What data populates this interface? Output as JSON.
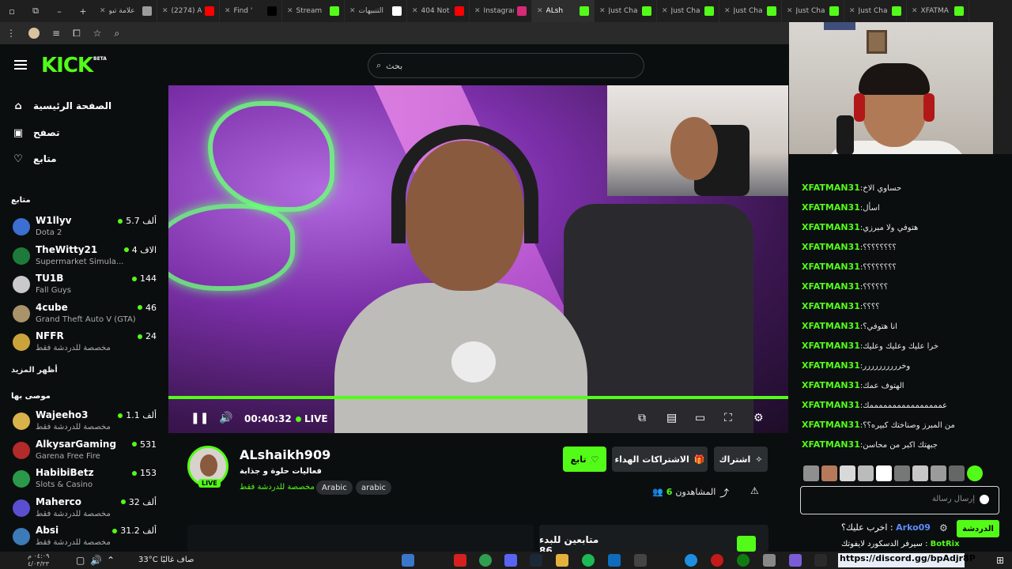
{
  "browser": {
    "tabs": [
      {
        "label": "علامة تبو",
        "color": "#9c9c9c"
      },
      {
        "label": "(2274) A",
        "color": "#ff0000"
      },
      {
        "label": "Find '",
        "color": "#000000"
      },
      {
        "label": "Stream",
        "color": "#53fc18"
      },
      {
        "label": "التنبيهات",
        "color": "#ffffff"
      },
      {
        "label": "404 Not",
        "color": "#ff0000"
      },
      {
        "label": "Instagran",
        "color": "#d62976"
      },
      {
        "label": "ALsh",
        "color": "#53fc18",
        "active": true
      },
      {
        "label": "Just Cha",
        "color": "#53fc18"
      },
      {
        "label": "Just Cha",
        "color": "#53fc18"
      },
      {
        "label": "Just Cha",
        "color": "#53fc18"
      },
      {
        "label": "Just Cha",
        "color": "#53fc18"
      },
      {
        "label": "Just Cha",
        "color": "#53fc18"
      },
      {
        "label": "XFATMA",
        "color": "#53fc18"
      }
    ]
  },
  "header": {
    "logo": "KICK",
    "beta": "BETA",
    "search_placeholder": "بحث"
  },
  "sidebar": {
    "nav": [
      {
        "label": "الصفحة الرئيسية",
        "icon": "home-icon"
      },
      {
        "label": "تصفح",
        "icon": "browse-icon"
      },
      {
        "label": "متابع",
        "icon": "heart-icon"
      }
    ],
    "following_title": "متابع",
    "following": [
      {
        "name": "W1llyv",
        "game": "Dota 2",
        "viewers": "5.7 ألف",
        "color": "#3b6fd1"
      },
      {
        "name": "TheWitty21",
        "game": "Supermarket Simula...",
        "viewers": "4 الاف",
        "color": "#1e7a3a"
      },
      {
        "name": "TU1B",
        "game": "Fall Guys",
        "viewers": "144",
        "color": "#c9c9c9"
      },
      {
        "name": "4cube",
        "game": "Grand Theft Auto V (GTA)",
        "viewers": "46",
        "color": "#a8936b"
      },
      {
        "name": "NFFR",
        "game": "مخصصة للدردشة فقط",
        "viewers": "24",
        "color": "#caa43a"
      }
    ],
    "show_more": "أظهر المزيد",
    "recommended_title": "موصى بها",
    "recommended": [
      {
        "name": "Wajeeho3",
        "game": "مخصصة للدردشة فقط",
        "viewers": "1.1 ألف",
        "color": "#d8b24a"
      },
      {
        "name": "AlkysarGaming",
        "game": "Garena Free Fire",
        "viewers": "531",
        "color": "#b22a2a"
      },
      {
        "name": "HabibiBetz",
        "game": "Slots & Casino",
        "viewers": "153",
        "color": "#2a9a4a"
      },
      {
        "name": "Maherco",
        "game": "مخصصة للدردشة فقط",
        "viewers": "32 ألف",
        "color": "#5a4fd1"
      },
      {
        "name": "Absi",
        "game": "مخصصة للدردشة فقط",
        "viewers": "31.2 ألف",
        "color": "#3c7ab8"
      }
    ]
  },
  "player": {
    "time": "00:40:32",
    "live": "LIVE",
    "progress": 1.0
  },
  "channel": {
    "name": "ALshaikh909",
    "title": "فعاليات حلوة و جذابة",
    "category": "مخصصة للدردشة فقط",
    "tags": [
      "Arabic",
      "arabic"
    ],
    "live_badge": "LIVE",
    "follow": "تابع",
    "gift": "الاشتراكات الهداء",
    "subscribe": "اشتراك",
    "viewers_label": "المشاهدون",
    "viewers": "6",
    "followers_label": "متابعين للبدء 86"
  },
  "chat": {
    "messages": [
      {
        "user": "XFATMAN31",
        "text": "حساوي الاخ"
      },
      {
        "user": "XFATMAN31",
        "text": "اسأل"
      },
      {
        "user": "XFATMAN31",
        "text": "هتوفي ولا مبرزي"
      },
      {
        "user": "XFATMAN31",
        "text": "؟؟؟؟؟؟؟؟"
      },
      {
        "user": "XFATMAN31",
        "text": "؟؟؟؟؟؟؟؟"
      },
      {
        "user": "XFATMAN31",
        "text": "؟؟؟؟؟؟"
      },
      {
        "user": "XFATMAN31",
        "text": "؟؟؟؟"
      },
      {
        "user": "XFATMAN31",
        "text": "انا هتوفي؟"
      },
      {
        "user": "XFATMAN31",
        "text": "خرا عليك وعليك وعليك"
      },
      {
        "user": "XFATMAN31",
        "text": "وخرررررررررر"
      },
      {
        "user": "XFATMAN31",
        "text": "الهتوف عمك"
      },
      {
        "user": "XFATMAN31",
        "text": "عممممممممممممممممك"
      },
      {
        "user": "XFATMAN31",
        "text": "من المبرز وصناختك كبيره؟؟"
      },
      {
        "user": "XFATMAN31",
        "text": "جبهتك اكبر من محاسن"
      }
    ],
    "input_placeholder": "إرسال رسالة",
    "chat_button": "الدردشة",
    "pinned_user": "Arko09",
    "pinned_text": "اخرب عليك؟ :",
    "pinned2_user": "BotRix",
    "pinned2_text": "سيرفر الدسكورد لايفوتك :",
    "discord_link": "https://discord.gg/bpAdjr8P"
  },
  "taskbar": {
    "date_line1": "٠٤:٠٩ م",
    "date_line2": "٤/٠٣/٢٣",
    "weather": "33°C  صاف غالبًا"
  }
}
